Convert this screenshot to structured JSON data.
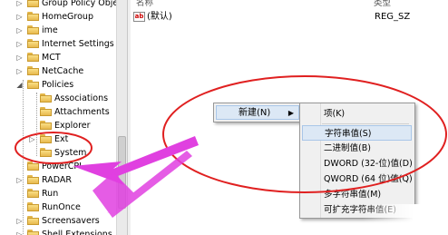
{
  "tree": {
    "items": [
      {
        "label": "Group Policy Objec",
        "expander": "▷"
      },
      {
        "label": "HomeGroup",
        "expander": "▷"
      },
      {
        "label": "ime",
        "expander": "▷"
      },
      {
        "label": "Internet Settings",
        "expander": "▷"
      },
      {
        "label": "MCT",
        "expander": "▷"
      },
      {
        "label": "NetCache",
        "expander": "▷"
      },
      {
        "label": "Policies",
        "expander": "◢"
      },
      {
        "label": "Associations",
        "expander": ""
      },
      {
        "label": "Attachments",
        "expander": ""
      },
      {
        "label": "Explorer",
        "expander": ""
      },
      {
        "label": "Ext",
        "expander": "▷"
      },
      {
        "label": "System",
        "expander": ""
      },
      {
        "label": "PowerCPL",
        "expander": ""
      },
      {
        "label": "RADAR",
        "expander": "▷"
      },
      {
        "label": "Run",
        "expander": ""
      },
      {
        "label": "RunOnce",
        "expander": ""
      },
      {
        "label": "Screensavers",
        "expander": "▷"
      },
      {
        "label": "Shell Extensions",
        "expander": "▷"
      }
    ]
  },
  "list": {
    "header_name": "名称",
    "header_type": "类型",
    "rows": [
      {
        "icon": "ab",
        "name": "(默认)",
        "type": "REG_SZ"
      }
    ]
  },
  "context_menu": {
    "new_label": "新建(N)",
    "submenu_arrow": "▶"
  },
  "submenu": {
    "items": [
      {
        "label": "项(K)"
      },
      {
        "label": "字符串值(S)"
      },
      {
        "label": "二进制值(B)"
      },
      {
        "label": "DWORD (32-位)值(D)"
      },
      {
        "label": "QWORD (64 位)值(Q)"
      },
      {
        "label": "多字符串值(M)"
      },
      {
        "label": "可扩充字符串值(E)"
      }
    ]
  },
  "colors": {
    "annotation_ellipse": "#e02020",
    "annotation_arrow": "#e040e0",
    "highlight": "#dce8f5"
  }
}
